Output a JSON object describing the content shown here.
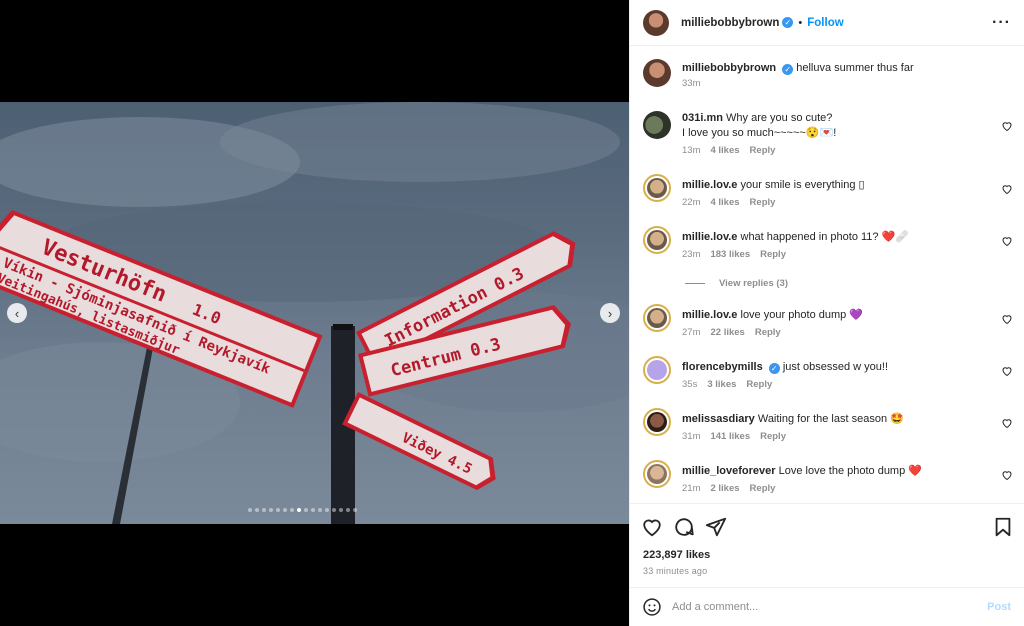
{
  "post": {
    "username": "milliebobbybrown",
    "follow_label": "Follow",
    "separator": "•",
    "more_icon": "more-horizontal-icon",
    "caption": "helluva summer thus far",
    "caption_time": "33m",
    "carousel": {
      "slide_count": 16,
      "active_index": 7,
      "prev_icon": "chevron-left-icon",
      "next_icon": "chevron-right-icon"
    },
    "sign_texts": {
      "left_top": "Vesturhöfn",
      "left_top_dist": "1.0",
      "left_mid": "Víkin - Sjóminjasafnið í Reykjavík",
      "left_bottom": "Veitingahús, listasmiðjur",
      "right_top": "Information 0.3",
      "right_mid": "Centrum 0.3",
      "right_bottom": "Viðey 4.5"
    }
  },
  "comments": [
    {
      "user": "031i.mn",
      "text": "Why are you so cute?",
      "text2": "I love you so much~~~~~😯💌!",
      "time": "13m",
      "likes": "4 likes",
      "reply": "Reply"
    },
    {
      "user": "millie.lov.e",
      "text": "your smile is everything ▯",
      "time": "22m",
      "likes": "4 likes",
      "reply": "Reply"
    },
    {
      "user": "millie.lov.e",
      "text": "what happened in photo 11? ❤️🩹",
      "time": "23m",
      "likes": "183 likes",
      "reply": "Reply"
    },
    {
      "user": "millie.lov.e",
      "text": "love your photo dump 💜",
      "time": "27m",
      "likes": "22 likes",
      "reply": "Reply"
    },
    {
      "user": "florencebymills",
      "text": "just obsessed w you!!",
      "time": "35s",
      "likes": "3 likes",
      "reply": "Reply"
    },
    {
      "user": "melissasdiary",
      "text": "Waiting for the last season 🤩",
      "time": "31m",
      "likes": "141 likes",
      "reply": "Reply"
    },
    {
      "user": "millie_loveforever",
      "text": "Love love the photo dump ❤️",
      "time": "21m",
      "likes": "2 likes",
      "reply": "Reply"
    }
  ],
  "view_replies": "View replies (3)",
  "footer": {
    "likes": "223,897 likes",
    "time_ago": "33 minutes ago",
    "icons": [
      "heart-icon",
      "comment-icon",
      "share-icon",
      "bookmark-icon"
    ]
  },
  "add_comment": {
    "placeholder": "Add a comment...",
    "post_label": "Post"
  },
  "colors": {
    "accent": "#0095f6",
    "verified": "#3897f0",
    "muted": "#8e8e8e",
    "sign_red": "#c8202f"
  }
}
